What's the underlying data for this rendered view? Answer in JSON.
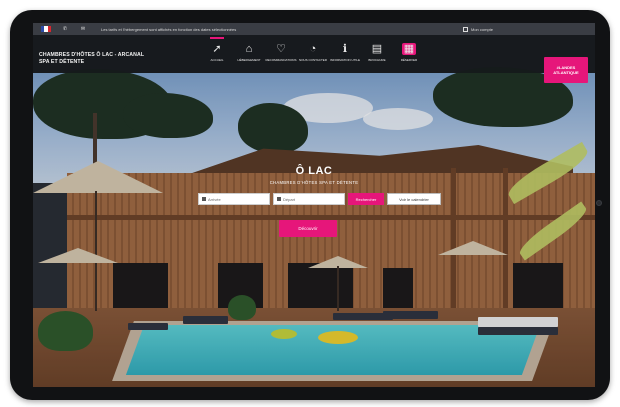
{
  "topbar": {
    "notice": "Les tarifs et l'hébergement sont affichés en fonction des dates sélectionnées",
    "account_label": "Mon compte"
  },
  "header": {
    "brand_line1": "CHAMBRES D'HÔTES Ô LAC - ARCANAL",
    "brand_line2": "SPA ET DÉTENTE",
    "nav": [
      {
        "label": "ACCUEIL",
        "icon": "pin-icon"
      },
      {
        "label": "HÉBERGEMENT",
        "icon": "home-icon"
      },
      {
        "label": "RECOMMANDATIONS",
        "icon": "heart-icon"
      },
      {
        "label": "NOUS CONTACTER",
        "icon": "rss-icon"
      },
      {
        "label": "INFORMATION UTILE",
        "icon": "info-icon"
      },
      {
        "label": "BROCHURE",
        "icon": "document-icon"
      },
      {
        "label": "RÉSERVER",
        "icon": "calendar-icon"
      }
    ],
    "badge_text": "#LANDES ATLANTIQUE"
  },
  "hero": {
    "title": "Ô LAC",
    "subtitle": "CHAMBRES D'HÔTES SPA ET DÉTENTE",
    "arrival_placeholder": "Arrivée",
    "departure_placeholder": "Départ",
    "search_label": "Rechercher",
    "calendar_label": "Voir le calendrier",
    "discover_label": "Découvrir"
  },
  "colors": {
    "accent": "#e6167a",
    "header_bg": "#14161a"
  }
}
